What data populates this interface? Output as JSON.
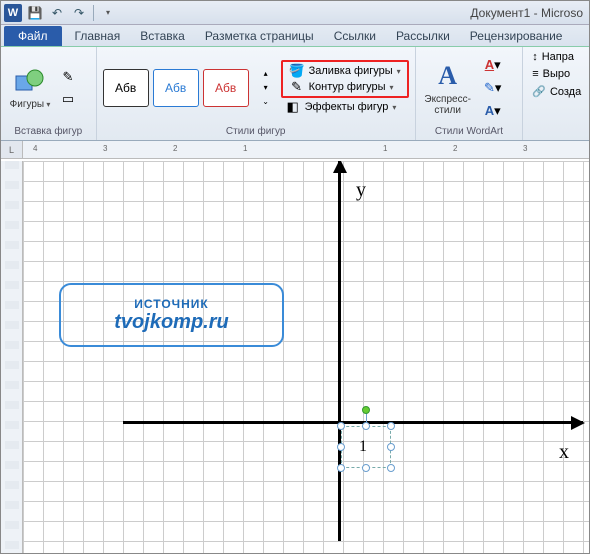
{
  "title": "Документ1 - Microso",
  "qat": {
    "word_letter": "W"
  },
  "tabs": {
    "file": "Файл",
    "items": [
      "Главная",
      "Вставка",
      "Разметка страницы",
      "Ссылки",
      "Рассылки",
      "Рецензирование"
    ]
  },
  "ribbon": {
    "shapes_group": {
      "button": "Фигуры",
      "label": "Вставка фигур"
    },
    "styles_group": {
      "sample_text": "Абв",
      "fill": "Заливка фигуры",
      "outline": "Контур фигуры",
      "effects": "Эффекты фигур",
      "label": "Стили фигур"
    },
    "wordart_group": {
      "button": "Экспресс-\nстили",
      "label": "Стили WordArt"
    },
    "edit_group": {
      "direction": "Напра",
      "align": "Выро",
      "create": "Созда"
    }
  },
  "ruler": {
    "corner": "L",
    "numbers": [
      "4",
      "3",
      "2",
      "1",
      "",
      "1",
      "2",
      "3"
    ]
  },
  "canvas": {
    "y_label": "y",
    "x_label": "x",
    "one_label": "1",
    "watermark_top": "ИСТОЧНИК",
    "watermark_bottom": "tvojkomp.ru"
  }
}
